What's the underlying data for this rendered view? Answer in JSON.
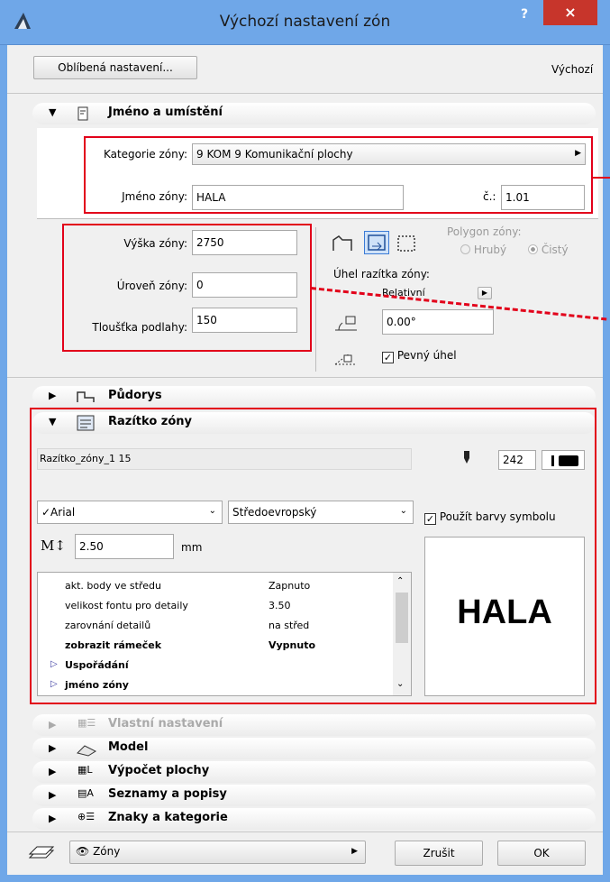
{
  "window": {
    "title": "Výchozí nastavení zón",
    "help": "?",
    "close": "×"
  },
  "toolbar": {
    "favorites_label": "Oblíbená nastavení...",
    "default_label": "Výchozí"
  },
  "sections": {
    "name_location": "Jméno a umístění",
    "floor_plan": "Půdorys",
    "zone_stamp": "Razítko zóny",
    "custom_settings": "Vlastní nastavení",
    "model": "Model",
    "area_calc": "Výpočet plochy",
    "lists_labels": "Seznamy a popisy",
    "tags_categories": "Znaky a kategorie"
  },
  "name_location": {
    "category_label": "Kategorie zóny:",
    "category_value": "9 KOM  9 Komunikační plochy",
    "zone_name_label": "Jméno zóny:",
    "zone_name_value": "HALA",
    "number_label": "č.:",
    "number_value": "1.01"
  },
  "geometry": {
    "height_label": "Výška zóny:",
    "height_value": "2750",
    "level_label": "Úroveň zóny:",
    "level_value": "0",
    "floor_thickness_label": "Tloušťka podlahy:",
    "floor_thickness_value": "150",
    "polygon_label": "Polygon zóny:",
    "rough_label": "Hrubý",
    "clean_label": "Čistý",
    "stamp_angle_label": "Úhel razítka zóny:",
    "relative_label": "Relativní",
    "angle_value": "0.00°",
    "fixed_angle_label": "Pevný úhel"
  },
  "stamp": {
    "stamp_name": "Razítko_zóny_1 15",
    "pen_value": "242",
    "font_value": "✓Arial",
    "charset_value": "Středoevropský",
    "use_symbol_colors_label": "Použít barvy symbolu",
    "text_size_value": "2.50",
    "unit_label": "mm",
    "preview_text": "HALA",
    "params": [
      {
        "name": "akt. body ve středu",
        "value": "Zapnuto",
        "bold": false,
        "group": false
      },
      {
        "name": "velikost fontu pro detaily",
        "value": "3.50",
        "bold": false,
        "group": false
      },
      {
        "name": "zarovnání detailů",
        "value": "na střed",
        "bold": false,
        "group": false
      },
      {
        "name": "zobrazit rámeček",
        "value": "Vypnuto",
        "bold": true,
        "group": false
      },
      {
        "name": "Uspořádání",
        "value": "",
        "bold": true,
        "group": true
      },
      {
        "name": "jméno zóny",
        "value": "",
        "bold": true,
        "group": true
      }
    ]
  },
  "footer": {
    "layer_value": "Zóny",
    "cancel_label": "Zrušit",
    "ok_label": "OK"
  },
  "colors": {
    "titlebar": "#6fa7e8",
    "close": "#c7352b",
    "highlight": "#e2001a"
  }
}
